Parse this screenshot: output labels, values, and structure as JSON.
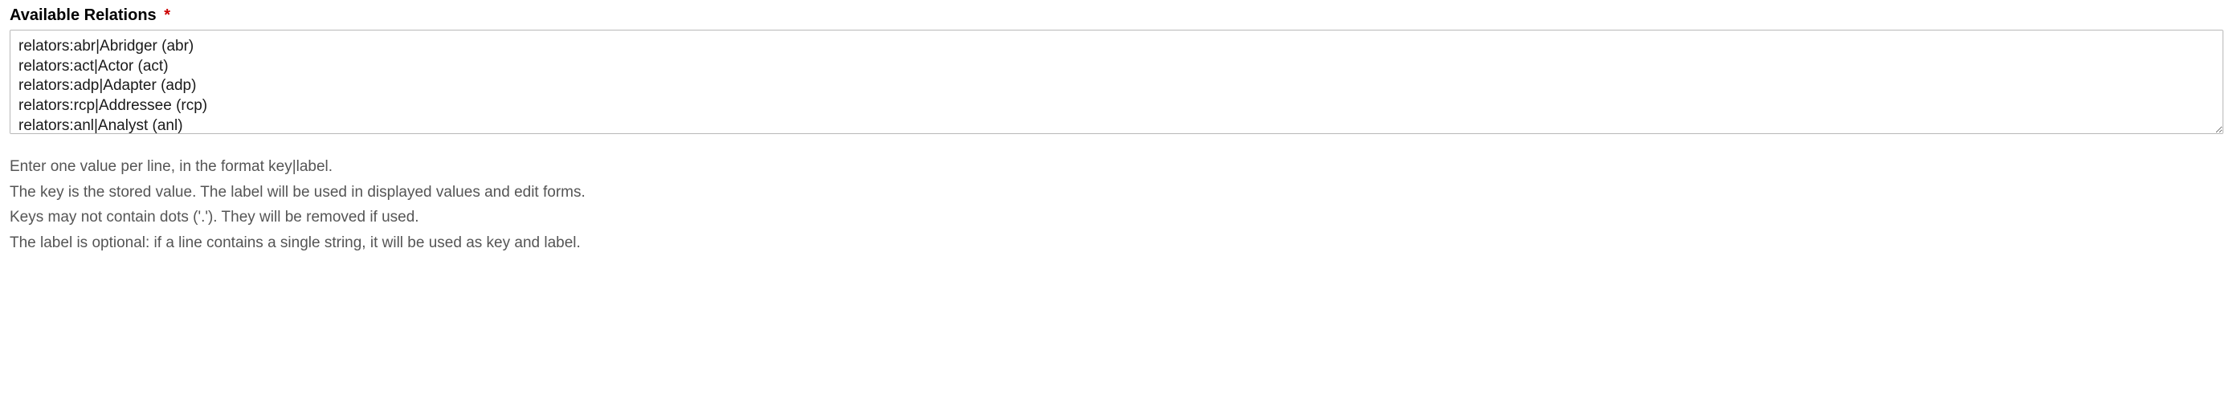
{
  "field": {
    "label": "Available Relations",
    "required_marker": "*",
    "value": "relators:abr|Abridger (abr)\nrelators:act|Actor (act)\nrelators:adp|Adapter (adp)\nrelators:rcp|Addressee (rcp)\nrelators:anl|Analyst (anl)"
  },
  "help": {
    "line1": "Enter one value per line, in the format key|label.",
    "line2": "The key is the stored value. The label will be used in displayed values and edit forms.",
    "line3": "Keys may not contain dots ('.'). They will be removed if used.",
    "line4": "The label is optional: if a line contains a single string, it will be used as key and label."
  }
}
